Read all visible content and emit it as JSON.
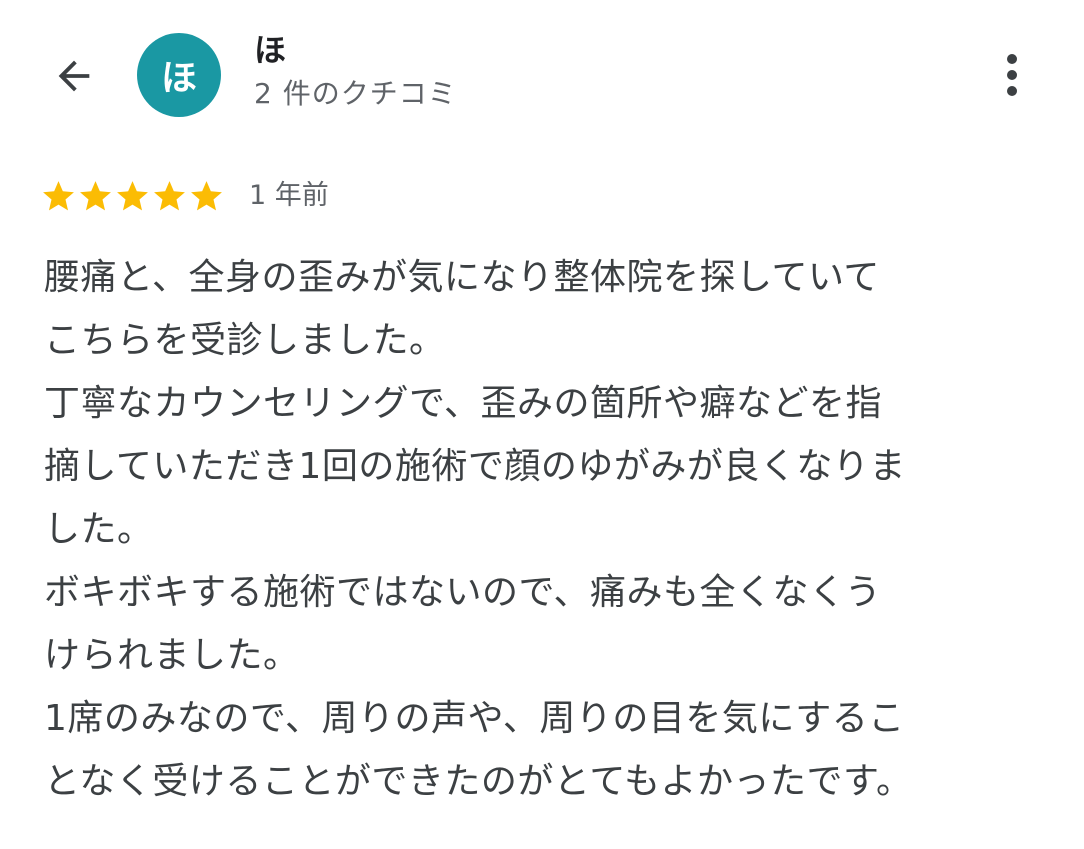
{
  "header": {
    "avatar_initial": "ほ",
    "user_name": "ほ",
    "review_count": "2 件のクチコミ"
  },
  "review": {
    "rating": 5,
    "max_rating": 5,
    "date": "1 年前",
    "text": "腰痛と、全身の歪みが気になり整体院を探していて\nこちらを受診しました。\n丁寧なカウンセリングで、歪みの箇所や癖などを指\n摘していただき1回の施術で顔のゆがみが良くなりま\nした。\nボキボキする施術ではないので、痛みも全くなくう\nけられました。\n1席のみなので、周りの声や、周りの目を気にするこ\nとなく受けることができたのがとてもよかったです。"
  },
  "colors": {
    "avatar_bg": "#1a98a3",
    "star": "#fbbc04",
    "secondary_text": "#5f6368"
  },
  "icons": {
    "back": "arrow-back-icon",
    "more": "more-vert-icon",
    "star": "star-icon"
  }
}
